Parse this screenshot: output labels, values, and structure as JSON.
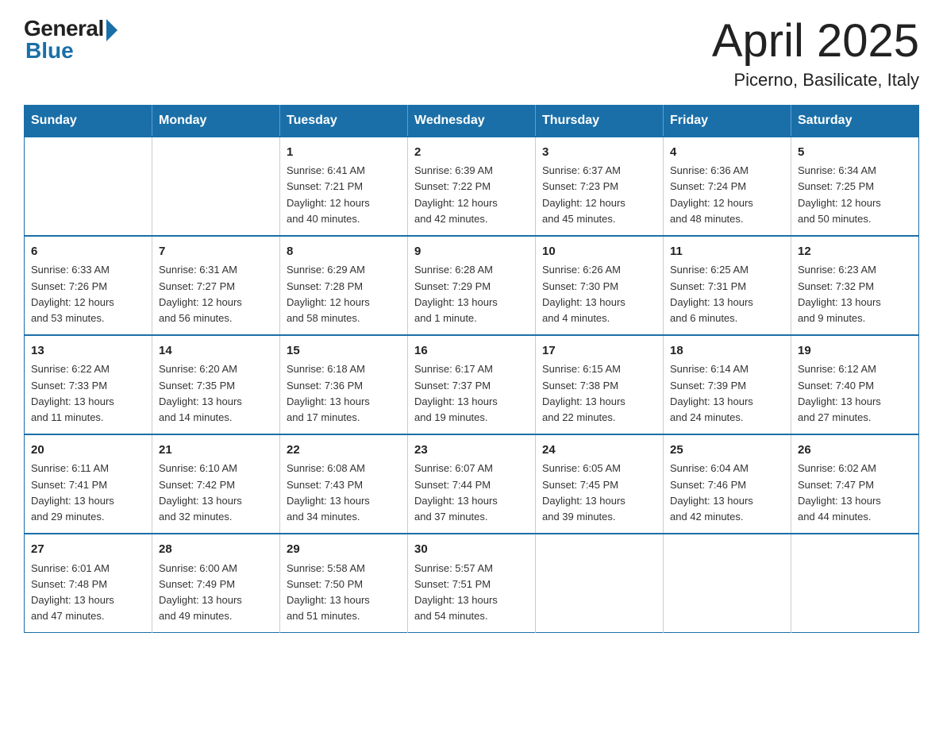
{
  "logo": {
    "general": "General",
    "blue": "Blue"
  },
  "title": "April 2025",
  "subtitle": "Picerno, Basilicate, Italy",
  "days_of_week": [
    "Sunday",
    "Monday",
    "Tuesday",
    "Wednesday",
    "Thursday",
    "Friday",
    "Saturday"
  ],
  "weeks": [
    [
      {
        "day": "",
        "info": ""
      },
      {
        "day": "",
        "info": ""
      },
      {
        "day": "1",
        "info": "Sunrise: 6:41 AM\nSunset: 7:21 PM\nDaylight: 12 hours\nand 40 minutes."
      },
      {
        "day": "2",
        "info": "Sunrise: 6:39 AM\nSunset: 7:22 PM\nDaylight: 12 hours\nand 42 minutes."
      },
      {
        "day": "3",
        "info": "Sunrise: 6:37 AM\nSunset: 7:23 PM\nDaylight: 12 hours\nand 45 minutes."
      },
      {
        "day": "4",
        "info": "Sunrise: 6:36 AM\nSunset: 7:24 PM\nDaylight: 12 hours\nand 48 minutes."
      },
      {
        "day": "5",
        "info": "Sunrise: 6:34 AM\nSunset: 7:25 PM\nDaylight: 12 hours\nand 50 minutes."
      }
    ],
    [
      {
        "day": "6",
        "info": "Sunrise: 6:33 AM\nSunset: 7:26 PM\nDaylight: 12 hours\nand 53 minutes."
      },
      {
        "day": "7",
        "info": "Sunrise: 6:31 AM\nSunset: 7:27 PM\nDaylight: 12 hours\nand 56 minutes."
      },
      {
        "day": "8",
        "info": "Sunrise: 6:29 AM\nSunset: 7:28 PM\nDaylight: 12 hours\nand 58 minutes."
      },
      {
        "day": "9",
        "info": "Sunrise: 6:28 AM\nSunset: 7:29 PM\nDaylight: 13 hours\nand 1 minute."
      },
      {
        "day": "10",
        "info": "Sunrise: 6:26 AM\nSunset: 7:30 PM\nDaylight: 13 hours\nand 4 minutes."
      },
      {
        "day": "11",
        "info": "Sunrise: 6:25 AM\nSunset: 7:31 PM\nDaylight: 13 hours\nand 6 minutes."
      },
      {
        "day": "12",
        "info": "Sunrise: 6:23 AM\nSunset: 7:32 PM\nDaylight: 13 hours\nand 9 minutes."
      }
    ],
    [
      {
        "day": "13",
        "info": "Sunrise: 6:22 AM\nSunset: 7:33 PM\nDaylight: 13 hours\nand 11 minutes."
      },
      {
        "day": "14",
        "info": "Sunrise: 6:20 AM\nSunset: 7:35 PM\nDaylight: 13 hours\nand 14 minutes."
      },
      {
        "day": "15",
        "info": "Sunrise: 6:18 AM\nSunset: 7:36 PM\nDaylight: 13 hours\nand 17 minutes."
      },
      {
        "day": "16",
        "info": "Sunrise: 6:17 AM\nSunset: 7:37 PM\nDaylight: 13 hours\nand 19 minutes."
      },
      {
        "day": "17",
        "info": "Sunrise: 6:15 AM\nSunset: 7:38 PM\nDaylight: 13 hours\nand 22 minutes."
      },
      {
        "day": "18",
        "info": "Sunrise: 6:14 AM\nSunset: 7:39 PM\nDaylight: 13 hours\nand 24 minutes."
      },
      {
        "day": "19",
        "info": "Sunrise: 6:12 AM\nSunset: 7:40 PM\nDaylight: 13 hours\nand 27 minutes."
      }
    ],
    [
      {
        "day": "20",
        "info": "Sunrise: 6:11 AM\nSunset: 7:41 PM\nDaylight: 13 hours\nand 29 minutes."
      },
      {
        "day": "21",
        "info": "Sunrise: 6:10 AM\nSunset: 7:42 PM\nDaylight: 13 hours\nand 32 minutes."
      },
      {
        "day": "22",
        "info": "Sunrise: 6:08 AM\nSunset: 7:43 PM\nDaylight: 13 hours\nand 34 minutes."
      },
      {
        "day": "23",
        "info": "Sunrise: 6:07 AM\nSunset: 7:44 PM\nDaylight: 13 hours\nand 37 minutes."
      },
      {
        "day": "24",
        "info": "Sunrise: 6:05 AM\nSunset: 7:45 PM\nDaylight: 13 hours\nand 39 minutes."
      },
      {
        "day": "25",
        "info": "Sunrise: 6:04 AM\nSunset: 7:46 PM\nDaylight: 13 hours\nand 42 minutes."
      },
      {
        "day": "26",
        "info": "Sunrise: 6:02 AM\nSunset: 7:47 PM\nDaylight: 13 hours\nand 44 minutes."
      }
    ],
    [
      {
        "day": "27",
        "info": "Sunrise: 6:01 AM\nSunset: 7:48 PM\nDaylight: 13 hours\nand 47 minutes."
      },
      {
        "day": "28",
        "info": "Sunrise: 6:00 AM\nSunset: 7:49 PM\nDaylight: 13 hours\nand 49 minutes."
      },
      {
        "day": "29",
        "info": "Sunrise: 5:58 AM\nSunset: 7:50 PM\nDaylight: 13 hours\nand 51 minutes."
      },
      {
        "day": "30",
        "info": "Sunrise: 5:57 AM\nSunset: 7:51 PM\nDaylight: 13 hours\nand 54 minutes."
      },
      {
        "day": "",
        "info": ""
      },
      {
        "day": "",
        "info": ""
      },
      {
        "day": "",
        "info": ""
      }
    ]
  ]
}
